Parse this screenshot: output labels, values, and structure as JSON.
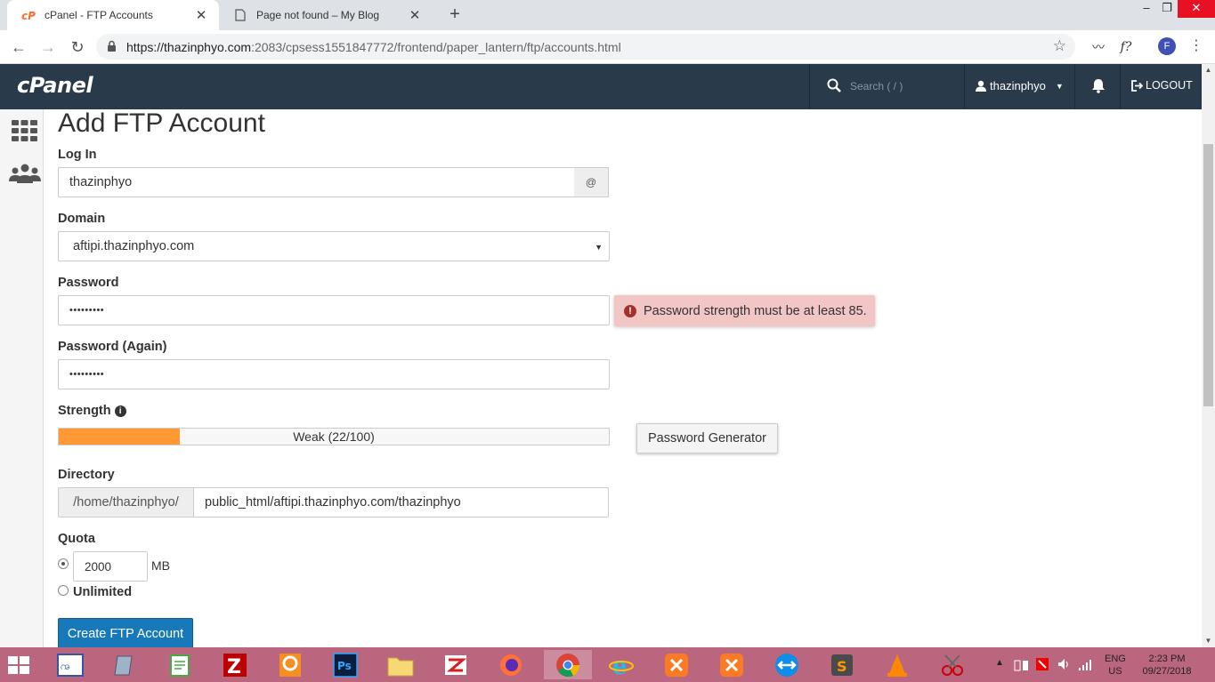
{
  "browser": {
    "tabs": [
      {
        "title": "cPanel - FTP Accounts",
        "active": true
      },
      {
        "title": "Page not found – My Blog",
        "active": false
      }
    ],
    "url_host": "https://thazinphyo.com",
    "url_rest": ":2083/cpsess1551847772/frontend/paper_lantern/ftp/accounts.html",
    "profile_initial": "F",
    "ext_label": "f?"
  },
  "header": {
    "logo": "cPanel",
    "search_placeholder": "Search ( / )",
    "username": "thazinphyo",
    "logout": "LOGOUT",
    "bg_color": "#293a4a"
  },
  "form": {
    "title": "Add FTP Account",
    "login_label": "Log In",
    "login_value": "thazinphyo",
    "login_addon": "@",
    "domain_label": "Domain",
    "domain_value": "aftipi.thazinphyo.com",
    "password_label": "Password",
    "password_value": "•••••••••",
    "password_error": "Password strength must be at least 85.",
    "password_again_label": "Password (Again)",
    "password_again_value": "•••••••••",
    "strength_label": "Strength",
    "strength_text": "Weak (22/100)",
    "strength_value": 22,
    "strength_color": "#ff9933",
    "password_generator": "Password Generator",
    "directory_label": "Directory",
    "directory_prefix": "/home/thazinphyo/",
    "directory_value": "public_html/aftipi.thazinphyo.com/thazinphyo",
    "quota_label": "Quota",
    "quota_value": "2000",
    "quota_unit": "MB",
    "unlimited_label": "Unlimited",
    "create_button": "Create FTP Account",
    "create_button_color": "#1779ba"
  },
  "taskbar": {
    "language": "ENG",
    "region": "US",
    "time": "2:23 PM",
    "date": "09/27/2018",
    "bg_color": "#b9667e"
  }
}
